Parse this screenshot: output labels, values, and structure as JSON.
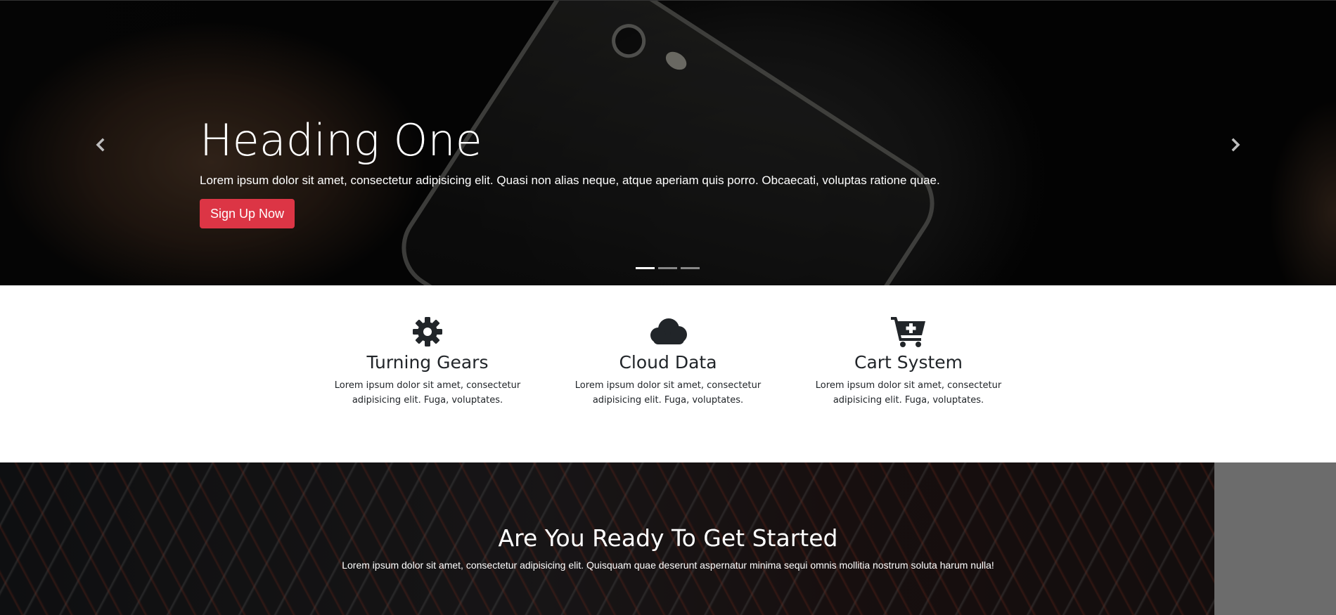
{
  "carousel": {
    "heading": "Heading One",
    "text": "Lorem ipsum dolor sit amet, consectetur adipisicing elit. Quasi non alias neque, atque aperiam quis porro. Obcaecati, voluptas ratione quae.",
    "button_label": "Sign Up Now",
    "button_color": "#dc3545",
    "prev_icon": "chevron-left-icon",
    "next_icon": "chevron-right-icon",
    "slide_count": 3,
    "active_slide": 1
  },
  "features": [
    {
      "icon": "gear-icon",
      "title": "Turning Gears",
      "text": "Lorem ipsum dolor sit amet, consectetur adipisicing elit. Fuga, voluptates."
    },
    {
      "icon": "cloud-icon",
      "title": "Cloud Data",
      "text": "Lorem ipsum dolor sit amet, consectetur adipisicing elit. Fuga, voluptates."
    },
    {
      "icon": "cart-plus-icon",
      "title": "Cart System",
      "text": "Lorem ipsum dolor sit amet, consectetur adipisicing elit. Fuga, voluptates."
    }
  ],
  "cta": {
    "title": "Are You Ready To Get Started",
    "text": "Lorem ipsum dolor sit amet, consectetur adipisicing elit. Quisquam quae deserunt aspernatur minima sequi omnis mollitia nostrum soluta harum nulla!"
  }
}
